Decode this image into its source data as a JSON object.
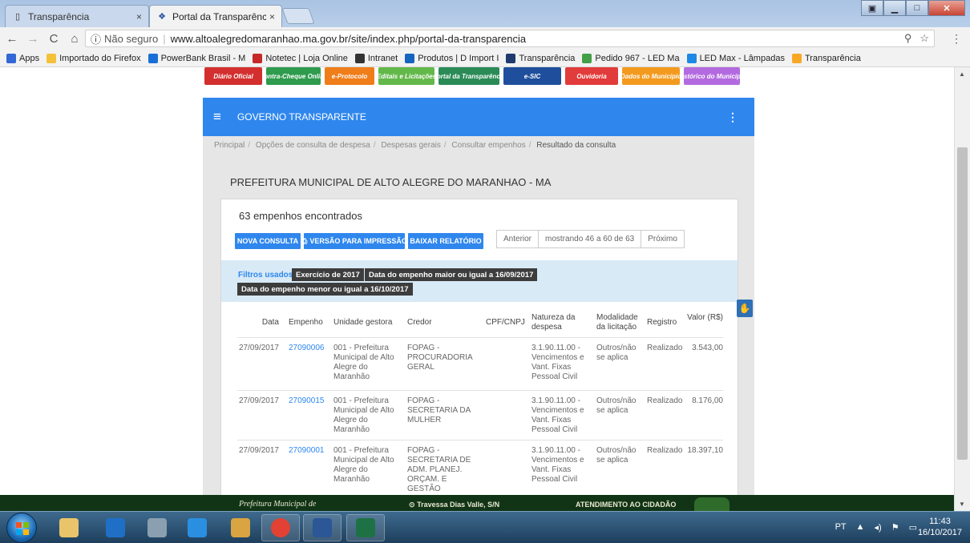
{
  "browser": {
    "tabs": [
      {
        "label": "Transparência",
        "active": false
      },
      {
        "label": "Portal da Transparência ·",
        "active": true
      }
    ],
    "close_glyph": "×",
    "security_label": "Não seguro",
    "url": "www.altoalegredomaranhao.ma.gov.br/site/index.php/portal-da-transparencia",
    "bookmarks": [
      {
        "label": "Apps",
        "icon": "apps-grid-icon",
        "color": "#3367d6"
      },
      {
        "label": "Importado do Firefox",
        "icon": "folder-icon",
        "color": "#f3c13a"
      },
      {
        "label": "PowerBank Brasil - M",
        "icon": "powerbank-icon",
        "color": "#1a6fd6"
      },
      {
        "label": "Notetec | Loja Online",
        "icon": "notetec-icon",
        "color": "#c62828"
      },
      {
        "label": "Intranet",
        "icon": "intranet-icon",
        "color": "#333333"
      },
      {
        "label": "Produtos | D Import I",
        "icon": "arrow-icon",
        "color": "#1565c0"
      },
      {
        "label": "Transparência",
        "icon": "monitor-icon",
        "color": "#1e3a6e"
      },
      {
        "label": "Pedido 967 - LED Ma",
        "icon": "cube-icon",
        "color": "#43a047"
      },
      {
        "label": "LED Max - Lâmpadas",
        "icon": "cube-icon",
        "color": "#1e88e5"
      },
      {
        "label": "Transparência",
        "icon": "info-icon",
        "color": "#f9a825"
      }
    ]
  },
  "quicklinks": [
    {
      "label": "Diário Oficial",
      "color": "#d32f2f"
    },
    {
      "label": "Contra-Cheque Online",
      "color": "#2e9b4d"
    },
    {
      "label": "e-Protocolo",
      "color": "#ef7d1a"
    },
    {
      "label": "Editais e Licitações",
      "color": "#63b84a"
    },
    {
      "label": "Portal da Transparência",
      "color": "#2a8b57"
    },
    {
      "label": "e-SIC",
      "color": "#1f4f9c"
    },
    {
      "label": "Ouvidoria",
      "color": "#e23b3b"
    },
    {
      "label": "Dados do Município",
      "color": "#f39a1e"
    },
    {
      "label": "Histórico do Município",
      "color": "#b36adf"
    }
  ],
  "header": {
    "title": "GOVERNO TRANSPARENTE"
  },
  "breadcrumb": [
    "Principal",
    "Opções de consulta de despesa",
    "Despesas gerais",
    "Consultar empenhos",
    "Resultado da consulta"
  ],
  "org_title": "PREFEITURA MUNICIPAL DE ALTO ALEGRE DO MARANHAO - MA",
  "result_count": "63 empenhos encontrados",
  "actions": {
    "new_query": "NOVA CONSULTA",
    "print": "VERSÃO PARA IMPRESSÃO",
    "download": "BAIXAR RELATÓRIO"
  },
  "pager": {
    "prev": "Anterior",
    "status": "mostrando 46 a 60 de 63",
    "next": "Próximo"
  },
  "filters": {
    "label": "Filtros usados:",
    "chips": [
      "Exercício de 2017",
      "Data do empenho maior ou igual a 16/09/2017",
      "Data do empenho menor ou igual a 16/10/2017"
    ]
  },
  "table": {
    "headers": {
      "data": "Data",
      "empenho": "Empenho",
      "unidade": "Unidade gestora",
      "credor": "Credor",
      "cpf": "CPF/CNPJ",
      "natureza": "Natureza da despesa",
      "modalidade": "Modalidade da licitação",
      "registro": "Registro",
      "valor": "Valor (R$)"
    },
    "rows": [
      {
        "data": "27/09/2017",
        "empenho": "27090006",
        "unidade": "001 - Prefeitura Municipal de Alto Alegre do Maranhão",
        "credor": "FOPAG - PROCURADORIA GERAL",
        "cpf": "",
        "natureza": "3.1.90.11.00 - Vencimentos e Vant. Fixas Pessoal Civil",
        "modalidade": "Outros/não se aplica",
        "registro": "Realizado",
        "valor": "3.543,00"
      },
      {
        "data": "27/09/2017",
        "empenho": "27090015",
        "unidade": "001 - Prefeitura Municipal de Alto Alegre do Maranhão",
        "credor": "FOPAG - SECRETARIA DA MULHER",
        "cpf": "",
        "natureza": "3.1.90.11.00 - Vencimentos e Vant. Fixas Pessoal Civil",
        "modalidade": "Outros/não se aplica",
        "registro": "Realizado",
        "valor": "8.176,00"
      },
      {
        "data": "27/09/2017",
        "empenho": "27090001",
        "unidade": "001 - Prefeitura Municipal de Alto Alegre do Maranhão",
        "credor": "FOPAG - SECRETARIA DE ADM. PLANEJ. ORÇAM. E GESTÃO",
        "cpf": "",
        "natureza": "3.1.90.11.00 - Vencimentos e Vant. Fixas Pessoal Civil",
        "modalidade": "Outros/não se aplica",
        "registro": "Realizado",
        "valor": "18.397,10"
      }
    ]
  },
  "footer": {
    "left": "Prefeitura Municipal de",
    "mid": "Travessa Dias Valle, S/N",
    "right": "ATENDIMENTO AO CIDADÃO"
  },
  "taskbar": {
    "apps": [
      {
        "icon": "file-explorer-icon",
        "color": "#e9c46a",
        "open": false
      },
      {
        "icon": "outlook-icon",
        "color": "#1f6fc6",
        "open": false
      },
      {
        "icon": "calculator-icon",
        "color": "#8aa0b0",
        "open": false
      },
      {
        "icon": "internet-explorer-icon",
        "color": "#2a8fe0",
        "open": false
      },
      {
        "icon": "paint-icon",
        "color": "#d9a441",
        "open": false
      },
      {
        "icon": "chrome-icon",
        "color": "#e34133",
        "open": true
      },
      {
        "icon": "word-icon",
        "color": "#2b5797",
        "open": true
      },
      {
        "icon": "excel-icon",
        "color": "#1e7145",
        "open": true
      }
    ],
    "lang": "PT",
    "time": "11:43",
    "date": "16/10/2017"
  }
}
